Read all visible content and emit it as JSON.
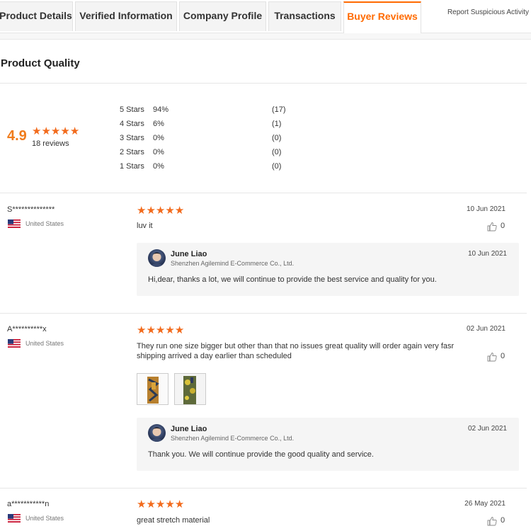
{
  "tabs": [
    {
      "label": "Product Details",
      "active": false
    },
    {
      "label": "Verified Information",
      "active": false
    },
    {
      "label": "Company Profile",
      "active": false
    },
    {
      "label": "Transactions",
      "active": false
    },
    {
      "label": "Buyer Reviews",
      "active": true
    }
  ],
  "report_link": "Report Suspicious Activity",
  "section_title": "Product Quality",
  "summary": {
    "score": "4.9",
    "star_count": 5,
    "reviews_text": "18 reviews",
    "distribution": [
      {
        "label": "5  Stars",
        "pct": "94%",
        "count": "(17)"
      },
      {
        "label": "4  Stars",
        "pct": "6%",
        "count": "(1)"
      },
      {
        "label": "3  Stars",
        "pct": "0%",
        "count": "(0)"
      },
      {
        "label": "2  Stars",
        "pct": "0%",
        "count": "(0)"
      },
      {
        "label": "1  Stars",
        "pct": "0%",
        "count": "(0)"
      }
    ]
  },
  "reviews": [
    {
      "user": "S**************",
      "country": "United States",
      "rating": 5,
      "text": "luv it",
      "date": "10 Jun 2021",
      "likes": "0",
      "reply": {
        "name": "June Liao",
        "company": "Shenzhen Agilemind E-Commerce Co., Ltd.",
        "date": "10 Jun 2021",
        "text": "Hi,dear, thanks a lot, we will continue to provide the best service and  quality for you."
      }
    },
    {
      "user": "A**********x",
      "country": "United States",
      "rating": 5,
      "text_line1": "They run one size bigger but other than that no issues great quality will order again very fasr",
      "text_line2": "shipping arrived a day earlier than scheduled",
      "date": "02 Jun 2021",
      "likes": "0",
      "reply": {
        "name": "June Liao",
        "company": "Shenzhen Agilemind E-Commerce Co., Ltd.",
        "date": "02 Jun 2021",
        "text": "Thank you. We will continue provide the good quality and service."
      }
    },
    {
      "user": "a***********n",
      "country": "United States",
      "rating": 5,
      "text": "great stretch material",
      "date": "26 May 2021",
      "likes": "0"
    }
  ],
  "colors": {
    "accent": "#ff6a00",
    "star": "#f26b1d",
    "score": "#f07c1c"
  }
}
